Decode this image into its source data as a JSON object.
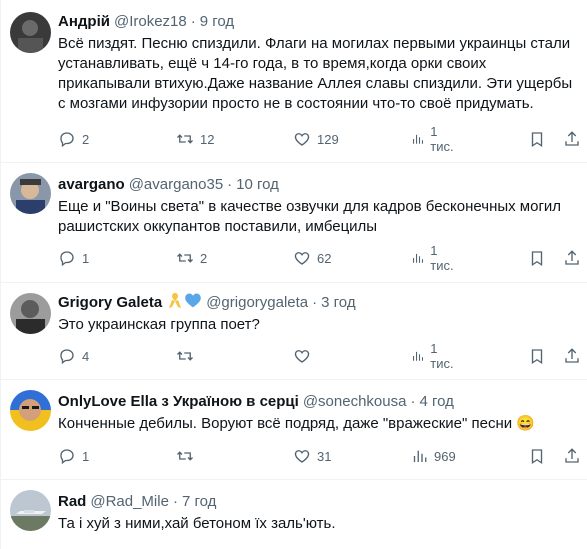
{
  "tweets": [
    {
      "name": "Андрій",
      "handle": "@Irokez18",
      "dot": "·",
      "time": "9 год",
      "text": "Всё пиздят. Песню спиздили. Флаги на могилах первыми украинцы стали устанавливать, ещё ч 14-го года, в то время,когда орки своих прикапывали втихую.Даже название Аллея славы спиздили. Эти ущербы с мозгами инфузории просто не в состоянии что-то своё придумать.",
      "replies": "2",
      "retweets": "12",
      "likes": "129",
      "views": "1 тис."
    },
    {
      "name": "avargano",
      "handle": "@avargano35",
      "dot": "·",
      "time": "10 год",
      "text": "Еще и \"Воины света\" в качестве озвучки для кадров бесконечных могил рашистских оккупантов поставили, имбецилы",
      "replies": "1",
      "retweets": "2",
      "likes": "62",
      "views": "1 тис."
    },
    {
      "name": "Grigory Galeta",
      "handle": "@grigorygaleta",
      "dot": "·",
      "time": "3 год",
      "text": "Это украинская группа поет?",
      "replies": "4",
      "retweets": "",
      "likes": "",
      "views": "1 тис."
    },
    {
      "name": "OnlyLove Ella з Україною в серці",
      "handle": "@sonechkousa",
      "dot": "·",
      "time": "4 год",
      "text": "Конченные дебилы. Воруют всё подряд, даже \"вражеские\" песни 😄",
      "replies": "1",
      "retweets": "",
      "likes": "31",
      "views": "969"
    },
    {
      "name": "Rad",
      "handle": "@Rad_Mile",
      "dot": "·",
      "time": "7 год",
      "text": "Та і хуй з ними,хай бетоном їх заль'ють."
    }
  ],
  "icons": {
    "reply": "reply-icon",
    "retweet": "retweet-icon",
    "like": "heart-icon",
    "views": "views-icon",
    "bookmark": "bookmark-icon",
    "share": "share-icon"
  },
  "colors": {
    "text": "#0f1419",
    "secondary": "#536471",
    "divider": "#eff3f4",
    "verified_blue": "#1d9bf0",
    "ribbon_gold": "#f5c542"
  }
}
